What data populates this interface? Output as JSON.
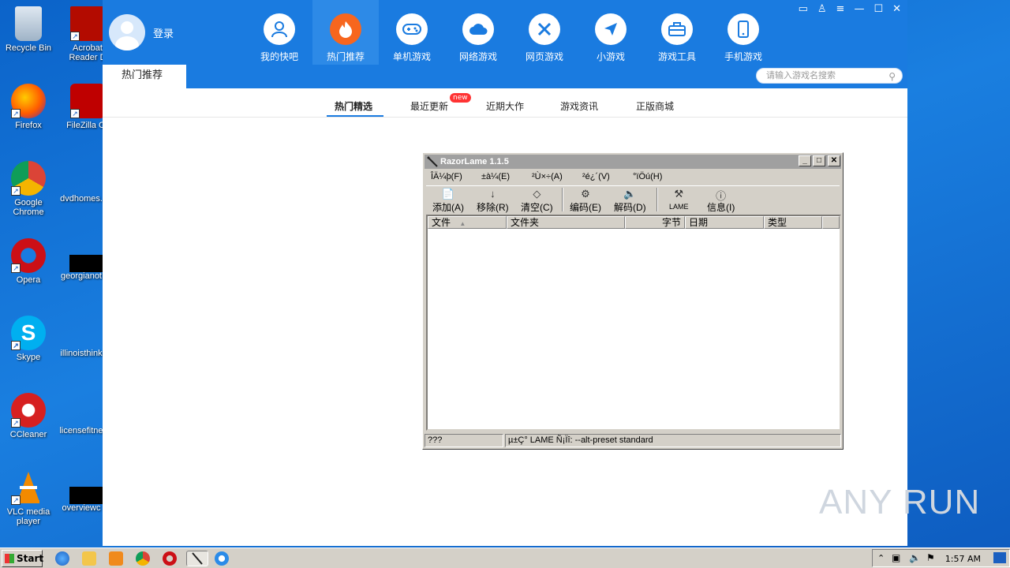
{
  "desktop": {
    "icons": [
      {
        "label": "Recycle Bin"
      },
      {
        "label": "Acrobat Reader D"
      },
      {
        "label": "Firefox"
      },
      {
        "label": "FileZilla Cli"
      },
      {
        "label": "Google Chrome"
      },
      {
        "label": "dvdhomes."
      },
      {
        "label": "Opera"
      },
      {
        "label": "georgianot"
      },
      {
        "label": "Skype"
      },
      {
        "label": "illinoisthink"
      },
      {
        "label": "CCleaner"
      },
      {
        "label": "licensefitne"
      },
      {
        "label": "VLC media player"
      },
      {
        "label": "overviewc"
      }
    ]
  },
  "app": {
    "login_label": "登录",
    "nav": [
      {
        "label": "我的快吧",
        "icon": "user-icon"
      },
      {
        "label": "热门推荐",
        "icon": "flame-icon",
        "active": true
      },
      {
        "label": "单机游戏",
        "icon": "gamepad-icon"
      },
      {
        "label": "网络游戏",
        "icon": "cloud-icon"
      },
      {
        "label": "网页游戏",
        "icon": "swords-icon"
      },
      {
        "label": "小游戏",
        "icon": "paper-plane-icon"
      },
      {
        "label": "游戏工具",
        "icon": "toolbox-icon"
      },
      {
        "label": "手机游戏",
        "icon": "phone-icon"
      }
    ],
    "search_placeholder": "请输入游戏名搜索",
    "hot_tab": "热门推荐",
    "subnav": [
      {
        "label": "热门精选",
        "active": true
      },
      {
        "label": "最近更新"
      },
      {
        "label": "近期大作"
      },
      {
        "label": "游戏资讯"
      },
      {
        "label": "正版商城"
      }
    ],
    "new_badge": "new"
  },
  "dialog": {
    "title": "RazorLame 1.1.5",
    "menu": [
      "ÎÄ¼þ(F)",
      "±à¼­(E)",
      "²Ù×÷(A)",
      "²é¿´(V)",
      "°ïÖú(H)"
    ],
    "toolbar": [
      {
        "label": "添加(A)",
        "icon": "add-file-icon"
      },
      {
        "label": "移除(R)",
        "icon": "remove-icon"
      },
      {
        "label": "清空(C)",
        "icon": "clear-icon"
      },
      {
        "label": "编码(E)",
        "icon": "encode-icon"
      },
      {
        "label": "解码(D)",
        "icon": "decode-icon"
      },
      {
        "label": "LAME",
        "icon": "tools-icon"
      },
      {
        "label": "信息(I)",
        "icon": "info-icon"
      }
    ],
    "columns": [
      "文件",
      "文件夹",
      "字节",
      "日期",
      "类型"
    ],
    "status_left": "???",
    "status_right": "µ±Ç° LAME Ñ¡Ïî:  --alt-preset standard"
  },
  "watermark": "ANY RUN",
  "taskbar": {
    "start_label": "Start",
    "clock": "1:57 AM"
  }
}
